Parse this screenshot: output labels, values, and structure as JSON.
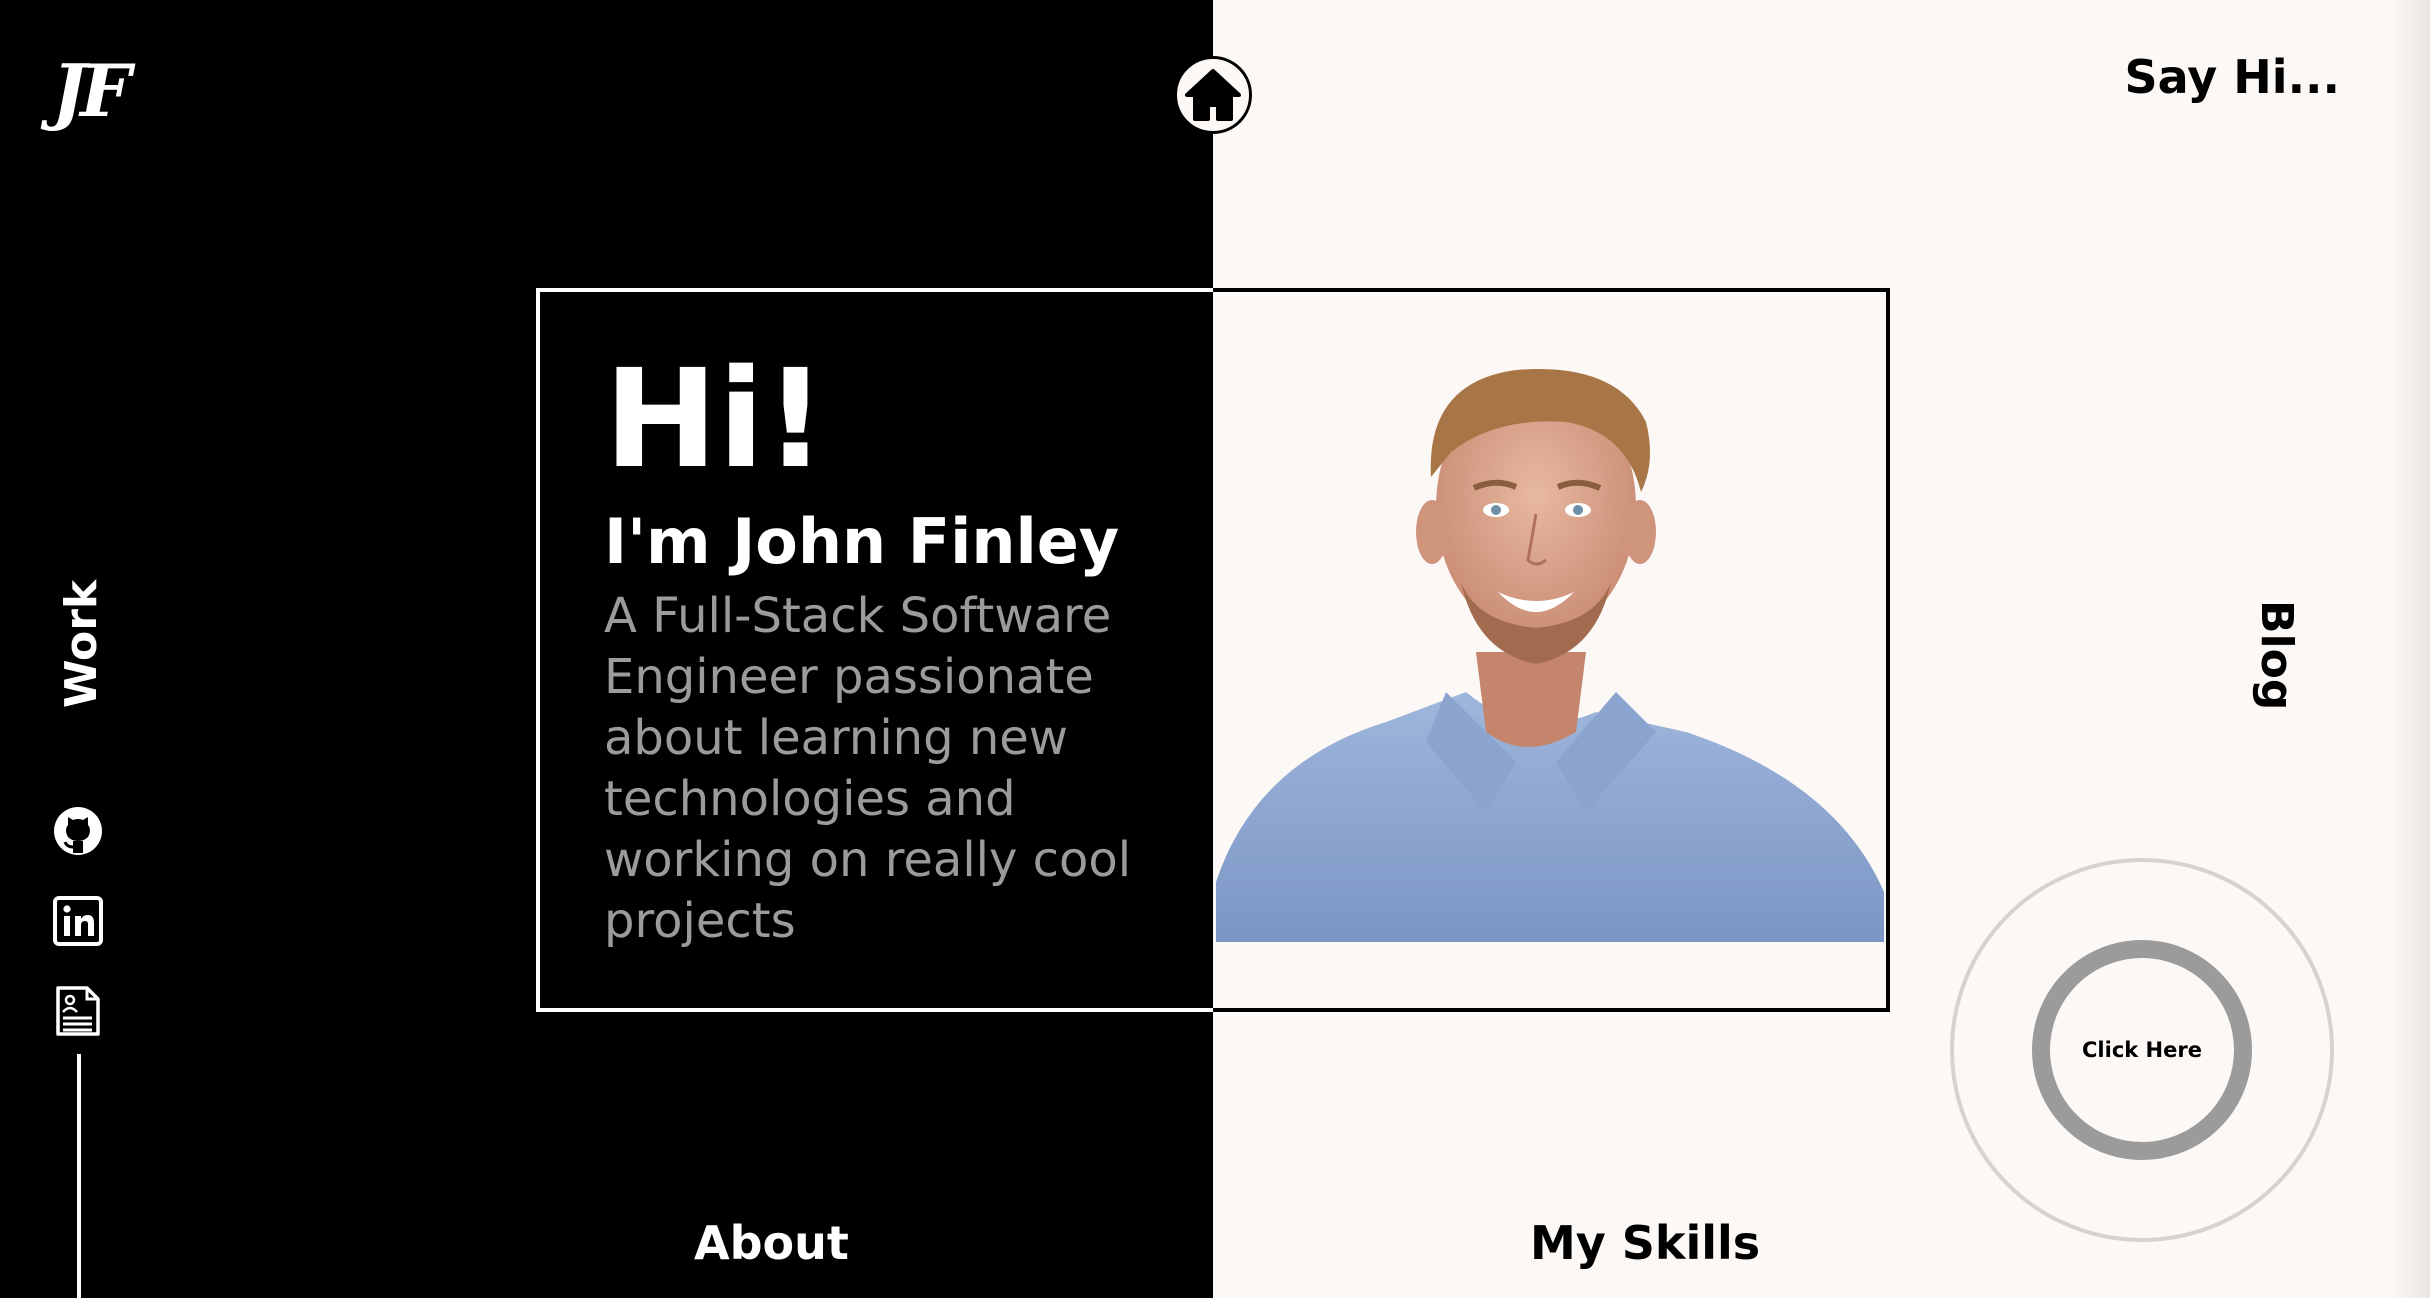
{
  "header": {
    "logo": "JF",
    "home_icon": "home-icon",
    "say_hi": "Say Hi..."
  },
  "nav": {
    "work": "Work",
    "blog": "Blog",
    "about": "About",
    "skills": "My Skills"
  },
  "social": [
    {
      "icon": "github-icon"
    },
    {
      "icon": "linkedin-icon"
    },
    {
      "icon": "resume-icon"
    }
  ],
  "hero": {
    "greeting": "Hi!",
    "name": "I'm John Finley",
    "description": "A Full-Stack Software Engineer passionate about learning new technologies and working on really cool projects",
    "photo_icon": "profile-photo"
  },
  "cta": {
    "label": "Click Here"
  },
  "colors": {
    "dark": "#000000",
    "light": "#fcf8f5",
    "muted": "#9b9b9b",
    "ring": "#d6d2cf"
  }
}
